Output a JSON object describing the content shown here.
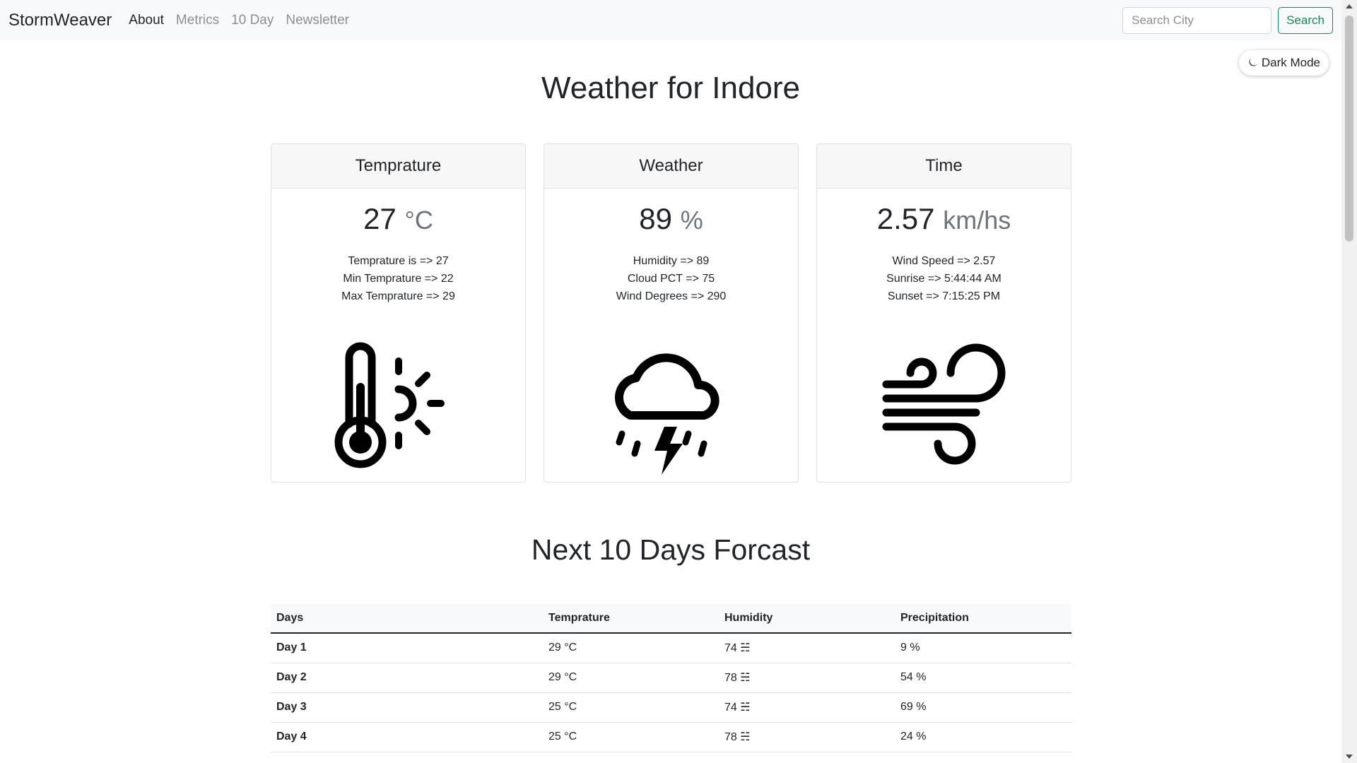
{
  "nav": {
    "brand": "StormWeaver",
    "links": [
      "About",
      "Metrics",
      "10 Day",
      "Newsletter"
    ],
    "search_placeholder": "Search City",
    "search_button": "Search"
  },
  "dark_mode": {
    "label": "Dark Mode",
    "icon": "moon-icon"
  },
  "title": "Weather for Indore",
  "cards": [
    {
      "header": "Temprature",
      "value": "27",
      "unit": "°C",
      "lines": [
        "Temprature is => 27",
        "Min Temprature => 22",
        "Max Temprature => 29"
      ],
      "icon": "thermometer-sun-icon"
    },
    {
      "header": "Weather",
      "value": "89",
      "unit": "%",
      "lines": [
        "Humidity => 89",
        "Cloud PCT => 75",
        "Wind Degrees => 290"
      ],
      "icon": "cloud-storm-icon"
    },
    {
      "header": "Time",
      "value": "2.57",
      "unit": "km/hs",
      "lines": [
        "Wind Speed => 2.57",
        "Sunrise => 5:44:44 AM",
        "Sunset => 7:15:25 PM"
      ],
      "icon": "wind-icon"
    }
  ],
  "forecast": {
    "title": "Next 10 Days Forcast",
    "headers": [
      "Days",
      "Temprature",
      "Humidity",
      "Precipitation"
    ],
    "rows": [
      [
        "Day 1",
        "29 °C",
        "74 ☵",
        "9 %"
      ],
      [
        "Day 2",
        "29 °C",
        "78 ☵",
        "54 %"
      ],
      [
        "Day 3",
        "25 °C",
        "74 ☵",
        "69 %"
      ],
      [
        "Day 4",
        "25 °C",
        "78 ☵",
        "24 %"
      ]
    ]
  }
}
